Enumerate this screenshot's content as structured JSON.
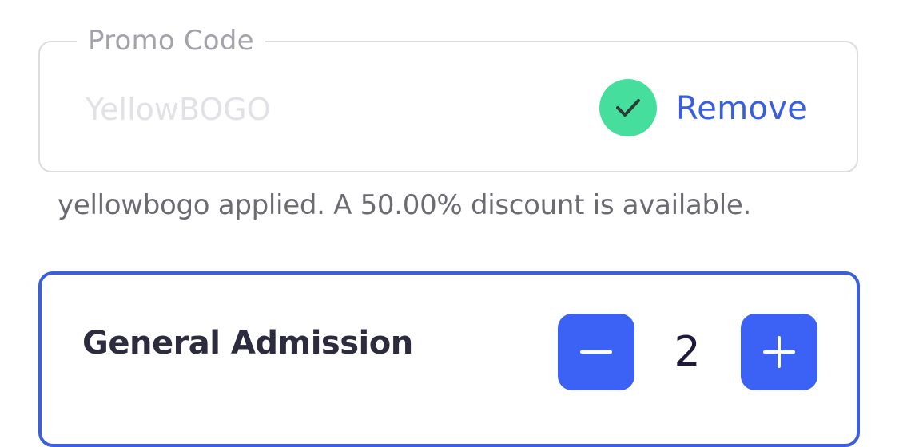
{
  "promo": {
    "legend": "Promo Code",
    "code_value": "YellowBOGO",
    "status_icon": "check-icon",
    "remove_label": "Remove",
    "applied_message": "yellowbogo applied. A 50.00% discount is available."
  },
  "ticket": {
    "name": "General Admission",
    "quantity": "2",
    "minus_icon": "minus-icon",
    "plus_icon": "plus-icon"
  },
  "colors": {
    "accent_blue": "#3b62f4",
    "link_blue": "#3a5ee0",
    "success_green": "#45de9c",
    "border_gray": "#dcdce0"
  }
}
